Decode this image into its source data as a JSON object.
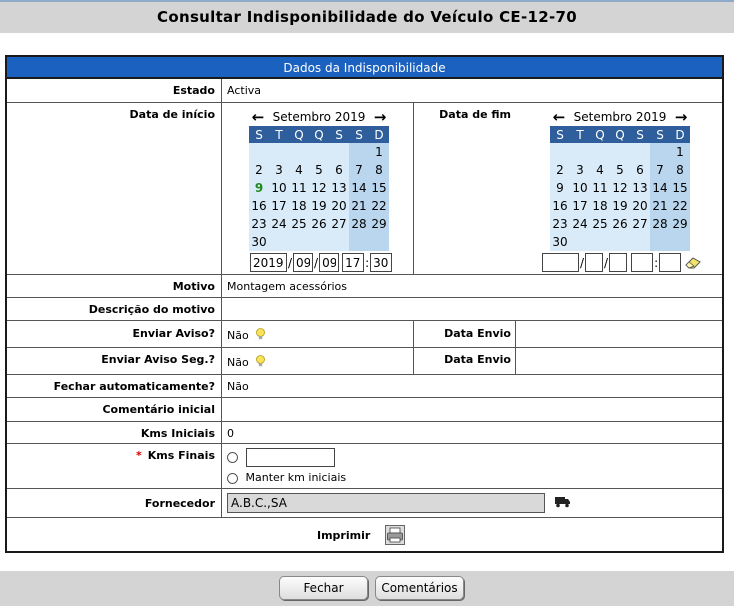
{
  "page": {
    "title": "Consultar Indisponibilidade do Veículo CE-12-70"
  },
  "panel": {
    "header": "Dados da Indisponibilidade"
  },
  "estado": {
    "label": "Estado",
    "value": "Activa"
  },
  "inicio": {
    "label": "Data de início",
    "month": "Setembro 2019",
    "weekdays": [
      "S",
      "T",
      "Q",
      "Q",
      "S",
      "S",
      "D"
    ],
    "weeks": [
      [
        "",
        "",
        "",
        "",
        "",
        "",
        "1"
      ],
      [
        "2",
        "3",
        "4",
        "5",
        "6",
        "7",
        "8"
      ],
      [
        "9",
        "10",
        "11",
        "12",
        "13",
        "14",
        "15"
      ],
      [
        "16",
        "17",
        "18",
        "19",
        "20",
        "21",
        "22"
      ],
      [
        "23",
        "24",
        "25",
        "26",
        "27",
        "28",
        "29"
      ],
      [
        "30",
        "",
        "",
        "",
        "",
        "",
        ""
      ]
    ],
    "today": "9",
    "year": "2019",
    "month_num": "09",
    "day": "09",
    "hour": "17",
    "minute": "30"
  },
  "fim": {
    "label": "Data de fim",
    "month": "Setembro 2019",
    "weekdays": [
      "S",
      "T",
      "Q",
      "Q",
      "S",
      "S",
      "D"
    ],
    "weeks": [
      [
        "",
        "",
        "",
        "",
        "",
        "",
        "1"
      ],
      [
        "2",
        "3",
        "4",
        "5",
        "6",
        "7",
        "8"
      ],
      [
        "9",
        "10",
        "11",
        "12",
        "13",
        "14",
        "15"
      ],
      [
        "16",
        "17",
        "18",
        "19",
        "20",
        "21",
        "22"
      ],
      [
        "23",
        "24",
        "25",
        "26",
        "27",
        "28",
        "29"
      ],
      [
        "30",
        "",
        "",
        "",
        "",
        "",
        ""
      ]
    ],
    "year": "",
    "month_num": "",
    "day": "",
    "hour": "",
    "minute": ""
  },
  "motivo": {
    "label": "Motivo",
    "value": "Montagem acessórios"
  },
  "descricao": {
    "label": "Descrição do motivo",
    "value": ""
  },
  "aviso": {
    "label": "Enviar Aviso?",
    "value": "Não",
    "envio_label": "Data Envio",
    "envio_value": ""
  },
  "aviso_seg": {
    "label": "Enviar Aviso Seg.?",
    "value": "Não",
    "envio_label": "Data Envio",
    "envio_value": ""
  },
  "fechar": {
    "label": "Fechar automaticamente?",
    "value": "Não"
  },
  "comentario": {
    "label": "Comentário inicial",
    "value": ""
  },
  "kms_iniciais": {
    "label": "Kms Iniciais",
    "value": "0"
  },
  "kms_finais": {
    "label": "Kms Finais",
    "required_mark": "*",
    "input_value": "",
    "option_keep": "Manter km iniciais"
  },
  "fornecedor": {
    "label": "Fornecedor",
    "value": "A.B.C.,SA"
  },
  "imprimir": {
    "label": "Imprimir"
  },
  "buttons": {
    "fechar": "Fechar",
    "comentarios": "Comentários"
  }
}
